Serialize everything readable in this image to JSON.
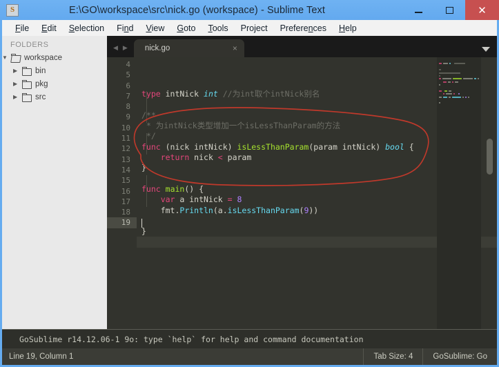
{
  "window": {
    "title": "E:\\GO\\workspace\\src\\nick.go (workspace) - Sublime Text",
    "app_icon_glyph": "S",
    "minimize_label": "–",
    "maximize_label": "□",
    "close_label": "✕",
    "accent_color": "#65acf0",
    "close_color": "#c75050"
  },
  "menubar": {
    "items": [
      {
        "label": "File",
        "mnemonic": "F"
      },
      {
        "label": "Edit",
        "mnemonic": "E"
      },
      {
        "label": "Selection",
        "mnemonic": "S"
      },
      {
        "label": "Find",
        "mnemonic": "n"
      },
      {
        "label": "View",
        "mnemonic": "V"
      },
      {
        "label": "Goto",
        "mnemonic": "G"
      },
      {
        "label": "Tools",
        "mnemonic": "T"
      },
      {
        "label": "Project",
        "mnemonic": ""
      },
      {
        "label": "Preferences",
        "mnemonic": "n"
      },
      {
        "label": "Help",
        "mnemonic": "H"
      }
    ]
  },
  "sidebar": {
    "header": "FOLDERS",
    "tree": [
      {
        "label": "workspace",
        "level": 0,
        "expanded": true,
        "arrow": "▼",
        "icon": "folder-open-icon"
      },
      {
        "label": "bin",
        "level": 1,
        "expanded": false,
        "arrow": "▶",
        "icon": "folder-icon"
      },
      {
        "label": "pkg",
        "level": 1,
        "expanded": false,
        "arrow": "▶",
        "icon": "folder-icon"
      },
      {
        "label": "src",
        "level": 1,
        "expanded": false,
        "arrow": "▶",
        "icon": "folder-icon"
      }
    ]
  },
  "tabs": {
    "prev_arrow": "◀",
    "next_arrow": "▶",
    "items": [
      {
        "label": "nick.go",
        "close_glyph": "×",
        "active": true
      }
    ],
    "dropdown_glyph": "▼"
  },
  "editor": {
    "first_visible_line": 4,
    "active_line": 19,
    "cursor_line": 19,
    "cursor_column": 1,
    "lines": [
      {
        "n": 4,
        "tokens": []
      },
      {
        "n": 5,
        "tokens": [
          {
            "t": "type",
            "c": "kw"
          },
          {
            "t": " intNick ",
            "c": "plain"
          },
          {
            "t": "int",
            "c": "type"
          },
          {
            "t": " ",
            "c": "plain"
          },
          {
            "t": "//为int取个intNick别名",
            "c": "cmt"
          }
        ]
      },
      {
        "n": 6,
        "tokens": []
      },
      {
        "n": 7,
        "tokens": [
          {
            "t": "/**",
            "c": "cmt"
          }
        ]
      },
      {
        "n": 8,
        "tokens": [
          {
            "t": " * 为intNick类型增加一个isLessThanParam的方法",
            "c": "cmt"
          }
        ]
      },
      {
        "n": 9,
        "tokens": [
          {
            "t": " */",
            "c": "cmt"
          }
        ]
      },
      {
        "n": 10,
        "tokens": [
          {
            "t": "func",
            "c": "kw"
          },
          {
            "t": " (nick intNick) ",
            "c": "plain"
          },
          {
            "t": "isLessThanParam",
            "c": "fn"
          },
          {
            "t": "(param intNick) ",
            "c": "plain"
          },
          {
            "t": "bool",
            "c": "type"
          },
          {
            "t": " {",
            "c": "plain"
          }
        ]
      },
      {
        "n": 11,
        "tokens": [
          {
            "t": "    ",
            "c": "plain"
          },
          {
            "t": "return",
            "c": "kw"
          },
          {
            "t": " nick ",
            "c": "plain"
          },
          {
            "t": "<",
            "c": "op"
          },
          {
            "t": " param",
            "c": "plain"
          }
        ]
      },
      {
        "n": 12,
        "tokens": [
          {
            "t": "}",
            "c": "plain"
          }
        ]
      },
      {
        "n": 13,
        "tokens": []
      },
      {
        "n": 14,
        "tokens": [
          {
            "t": "func",
            "c": "kw"
          },
          {
            "t": " ",
            "c": "plain"
          },
          {
            "t": "main",
            "c": "fn"
          },
          {
            "t": "() {",
            "c": "plain"
          }
        ]
      },
      {
        "n": 15,
        "tokens": [
          {
            "t": "    ",
            "c": "plain"
          },
          {
            "t": "var",
            "c": "kw"
          },
          {
            "t": " a intNick ",
            "c": "plain"
          },
          {
            "t": "=",
            "c": "op"
          },
          {
            "t": " ",
            "c": "plain"
          },
          {
            "t": "8",
            "c": "num"
          }
        ]
      },
      {
        "n": 16,
        "tokens": [
          {
            "t": "    fmt.",
            "c": "plain"
          },
          {
            "t": "Println",
            "c": "blue"
          },
          {
            "t": "(a.",
            "c": "plain"
          },
          {
            "t": "isLessThanParam",
            "c": "blue"
          },
          {
            "t": "(",
            "c": "plain"
          },
          {
            "t": "9",
            "c": "num"
          },
          {
            "t": "))",
            "c": "plain"
          }
        ]
      },
      {
        "n": 17,
        "tokens": []
      },
      {
        "n": 18,
        "tokens": [
          {
            "t": "}",
            "c": "plain"
          }
        ]
      },
      {
        "n": 19,
        "tokens": []
      }
    ],
    "annotation": {
      "shape": "hand-drawn-ellipse",
      "color": "#c0392b",
      "encircles_lines": [
        10,
        11,
        12
      ]
    }
  },
  "console": {
    "text": "GoSublime r14.12.06-1 9o: type `help` for help and command documentation"
  },
  "statusbar": {
    "position": "Line 19, Column 1",
    "tab_size": "Tab Size: 4",
    "syntax": "GoSublime: Go"
  }
}
